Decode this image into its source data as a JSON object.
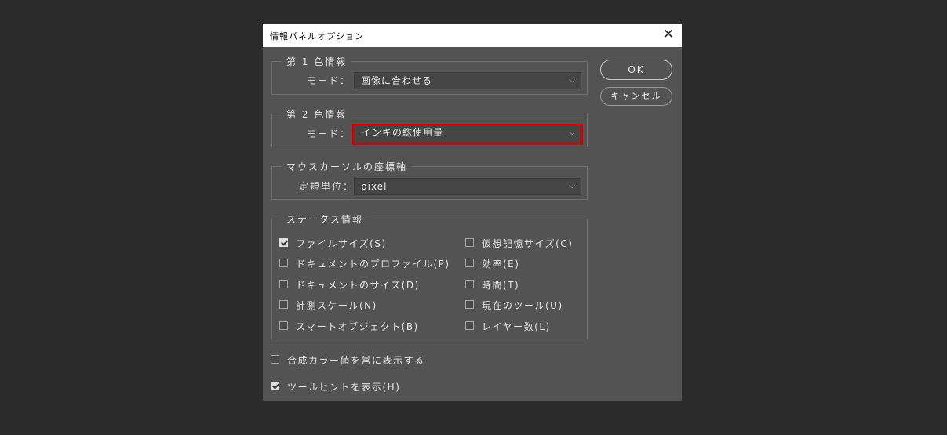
{
  "dialog": {
    "title": "情報パネルオプション",
    "close_glyph": "✕"
  },
  "first_color": {
    "legend": "第 1 色情報",
    "mode_label": "モード：",
    "mode_value": "画像に合わせる"
  },
  "second_color": {
    "legend": "第 2 色情報",
    "mode_label": "モード：",
    "mode_value": "インキの総使用量",
    "highlight_color": "#d40000"
  },
  "mouse": {
    "legend": "マウスカーソルの座標軸",
    "unit_label": "定規単位：",
    "unit_value": "pixel"
  },
  "status": {
    "legend": "ステータス情報",
    "left": [
      {
        "label": "ファイルサイズ(S)",
        "checked": true
      },
      {
        "label": "ドキュメントのプロファイル(P)",
        "checked": false
      },
      {
        "label": "ドキュメントのサイズ(D)",
        "checked": false
      },
      {
        "label": "計測スケール(N)",
        "checked": false
      },
      {
        "label": "スマートオブジェクト(B)",
        "checked": false
      }
    ],
    "right": [
      {
        "label": "仮想記憶サイズ(C)",
        "checked": false
      },
      {
        "label": "効率(E)",
        "checked": false
      },
      {
        "label": "時間(T)",
        "checked": false
      },
      {
        "label": "現在のツール(U)",
        "checked": false
      },
      {
        "label": "レイヤー数(L)",
        "checked": false
      }
    ]
  },
  "options": {
    "composite_label": "合成カラー値を常に表示する",
    "composite_checked": false,
    "tooltips_label": "ツールヒントを表示(H)",
    "tooltips_checked": true
  },
  "buttons": {
    "ok": "OK",
    "cancel": "キャンセル"
  },
  "chevron": "⌵"
}
